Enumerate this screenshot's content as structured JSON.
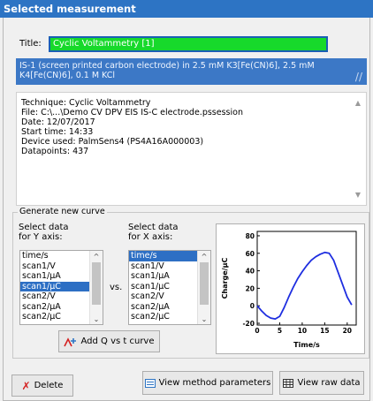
{
  "window_title": "Selected measurement",
  "title_label": "Title:",
  "title_value": "Cyclic Voltammetry [1]",
  "selected_description": "IS-1 (screen printed carbon electrode) in 2.5 mM K3[Fe(CN)6], 2.5 mM K4[Fe(CN)6], 0.1 M KCl",
  "info": {
    "technique": "Technique: Cyclic Voltammetry",
    "file": "File: C:\\...\\Demo CV DPV EIS IS-C electrode.pssession",
    "date": "Date: 12/07/2017",
    "start_time": "Start time: 14:33",
    "device": "Device used: PalmSens4 (PS4A16A000003)",
    "datapoints": "Datapoints: 437"
  },
  "generate": {
    "group_title": "Generate new curve",
    "y_label_1": "Select data",
    "y_label_2": "for Y axis:",
    "x_label_1": "Select data",
    "x_label_2": "for X axis:",
    "vs": "vs.",
    "y_items": [
      "time/s",
      "scan1/V",
      "scan1/µA",
      "scan1/µC",
      "scan2/V",
      "scan2/µA",
      "scan2/µC"
    ],
    "y_selected": 3,
    "x_items": [
      "time/s",
      "scan1/V",
      "scan1/µA",
      "scan1/µC",
      "scan2/V",
      "scan2/µA",
      "scan2/µC"
    ],
    "x_selected": 0,
    "add_button": "Add Q vs t curve"
  },
  "buttons": {
    "delete": "Delete",
    "view_method": "View method parameters",
    "view_raw": "View raw data"
  },
  "colors": {
    "accent": "#2d74c4",
    "title_field": "#17d92b",
    "curve": "#1e2ee0",
    "delete_x": "#d42020"
  },
  "chart_data": {
    "type": "line",
    "xlabel": "Time/s",
    "ylabel": "Charge/µC",
    "xlim": [
      0,
      22
    ],
    "ylim": [
      -22,
      85
    ],
    "xticks": [
      0,
      5,
      10,
      15,
      20
    ],
    "yticks": [
      -20,
      0,
      20,
      40,
      60,
      80
    ],
    "series": [
      {
        "x": [
          0,
          1,
          2,
          3,
          4,
          5,
          6,
          7,
          8,
          9,
          10,
          11,
          12,
          13,
          14,
          15,
          16,
          17,
          18,
          19,
          20,
          21
        ],
        "y": [
          0,
          -6,
          -11,
          -14,
          -15,
          -12,
          -2,
          10,
          21,
          31,
          39,
          46,
          52,
          56,
          59,
          61,
          60,
          52,
          38,
          24,
          10,
          1
        ]
      }
    ]
  }
}
